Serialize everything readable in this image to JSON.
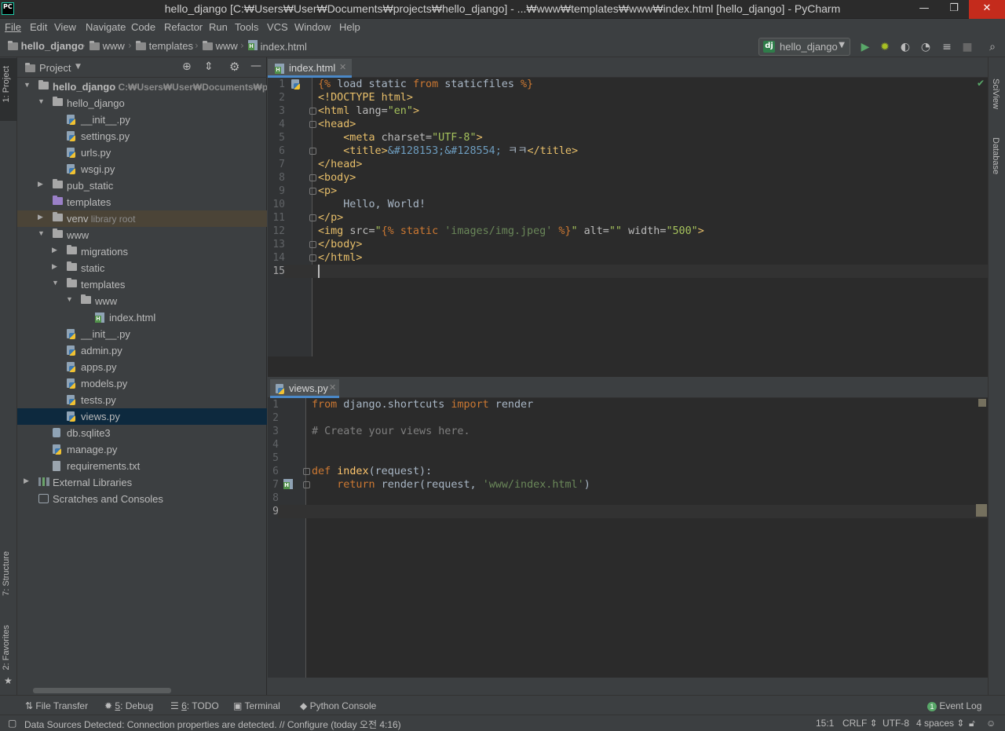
{
  "window": {
    "title": "hello_django [C:₩Users₩User₩Documents₩projects₩hello_django] - ...₩www₩templates₩www₩index.html [hello_django] - PyCharm",
    "logo": "PC",
    "minimize": "—",
    "maximize": "❐",
    "close": "✕"
  },
  "menu": [
    "File",
    "Edit",
    "View",
    "Navigate",
    "Code",
    "Refactor",
    "Run",
    "Tools",
    "VCS",
    "Window",
    "Help"
  ],
  "breadcrumb": [
    "hello_django",
    "www",
    "templates",
    "www",
    "index.html"
  ],
  "run_config": {
    "icon": "dj",
    "label": "hello_django"
  },
  "left_tool_tabs": {
    "project": "1: Project",
    "structure": "7: Structure",
    "favorites": "2: Favorites"
  },
  "right_tool_tabs": {
    "sciview": "SciView",
    "database": "Database"
  },
  "project_panel": {
    "title": "Project",
    "tree": [
      {
        "label": "hello_django",
        "extra": "C:₩Users₩User₩Documents₩projects",
        "icon": "folder",
        "arrow": "▼",
        "bold": true
      },
      {
        "label": "hello_django",
        "icon": "folder",
        "arrow": "▼"
      },
      {
        "label": "__init__.py",
        "icon": "python-file"
      },
      {
        "label": "settings.py",
        "icon": "python-file"
      },
      {
        "label": "urls.py",
        "icon": "python-file"
      },
      {
        "label": "wsgi.py",
        "icon": "python-file"
      },
      {
        "label": "pub_static",
        "icon": "folder",
        "arrow": "▶"
      },
      {
        "label": "templates",
        "icon": "folder-purple"
      },
      {
        "label": "venv",
        "extra": "library root",
        "icon": "folder",
        "arrow": "▶"
      },
      {
        "label": "www",
        "icon": "folder",
        "arrow": "▼"
      },
      {
        "label": "migrations",
        "icon": "folder",
        "arrow": "▶"
      },
      {
        "label": "static",
        "icon": "folder",
        "arrow": "▶"
      },
      {
        "label": "templates",
        "icon": "folder",
        "arrow": "▼"
      },
      {
        "label": "www",
        "icon": "folder",
        "arrow": "▼"
      },
      {
        "label": "index.html",
        "icon": "html-file"
      },
      {
        "label": "__init__.py",
        "icon": "python-file"
      },
      {
        "label": "admin.py",
        "icon": "python-file"
      },
      {
        "label": "apps.py",
        "icon": "python-file"
      },
      {
        "label": "models.py",
        "icon": "python-file"
      },
      {
        "label": "tests.py",
        "icon": "python-file"
      },
      {
        "label": "views.py",
        "icon": "python-file"
      },
      {
        "label": "db.sqlite3",
        "icon": "db-file"
      },
      {
        "label": "manage.py",
        "icon": "python-file"
      },
      {
        "label": "requirements.txt",
        "icon": "text-file"
      },
      {
        "label": "External Libraries",
        "icon": "library",
        "arrow": "▶"
      },
      {
        "label": "Scratches and Consoles",
        "icon": "scratches"
      }
    ]
  },
  "editor_top": {
    "tab": "index.html",
    "line_numbers": [
      "1",
      "2",
      "3",
      "4",
      "5",
      "6",
      "7",
      "8",
      "9",
      "10",
      "11",
      "12",
      "13",
      "14",
      "15"
    ],
    "lines": [
      [
        {
          "t": "{% ",
          "c": "templ"
        },
        {
          "t": "load static ",
          "c": "plain"
        },
        {
          "t": "from",
          "c": "kw"
        },
        {
          "t": " staticfiles ",
          "c": "plain"
        },
        {
          "t": "%}",
          "c": "templ"
        }
      ],
      [
        {
          "t": "<!DOCTYPE html>",
          "c": "tag"
        }
      ],
      [
        {
          "t": "<html ",
          "c": "tag"
        },
        {
          "t": "lang=",
          "c": "attr"
        },
        {
          "t": "\"en\"",
          "c": "val"
        },
        {
          "t": ">",
          "c": "tag"
        }
      ],
      [
        {
          "t": "<head>",
          "c": "tag"
        }
      ],
      [
        {
          "t": "    ",
          "c": "plain"
        },
        {
          "t": "<meta ",
          "c": "tag"
        },
        {
          "t": "charset=",
          "c": "attr"
        },
        {
          "t": "\"UTF-8\"",
          "c": "val"
        },
        {
          "t": ">",
          "c": "tag"
        }
      ],
      [
        {
          "t": "    ",
          "c": "plain"
        },
        {
          "t": "<title>",
          "c": "tag"
        },
        {
          "t": "&#128153;&#128554;",
          "c": "ent"
        },
        {
          "t": " ㅋㅋ",
          "c": "plain"
        },
        {
          "t": "</title>",
          "c": "tag"
        }
      ],
      [
        {
          "t": "</head>",
          "c": "tag"
        }
      ],
      [
        {
          "t": "<body>",
          "c": "tag"
        }
      ],
      [
        {
          "t": "<p>",
          "c": "tag"
        }
      ],
      [
        {
          "t": "    Hello, World!",
          "c": "plain"
        }
      ],
      [
        {
          "t": "</p>",
          "c": "tag"
        }
      ],
      [
        {
          "t": "<img ",
          "c": "tag"
        },
        {
          "t": "src=",
          "c": "attr"
        },
        {
          "t": "\"",
          "c": "val"
        },
        {
          "t": "{% ",
          "c": "templ"
        },
        {
          "t": "static ",
          "c": "kw"
        },
        {
          "t": "'images/img.jpeg'",
          "c": "str"
        },
        {
          "t": " %}",
          "c": "templ"
        },
        {
          "t": "\" ",
          "c": "val"
        },
        {
          "t": "alt=",
          "c": "attr"
        },
        {
          "t": "\"\" ",
          "c": "val"
        },
        {
          "t": "width=",
          "c": "attr"
        },
        {
          "t": "\"500\"",
          "c": "val"
        },
        {
          "t": ">",
          "c": "tag"
        }
      ],
      [
        {
          "t": "</body>",
          "c": "tag"
        }
      ],
      [
        {
          "t": "</html>",
          "c": "tag"
        }
      ],
      []
    ]
  },
  "editor_bottom": {
    "tab": "views.py",
    "line_numbers": [
      "1",
      "2",
      "3",
      "4",
      "5",
      "6",
      "7",
      "8",
      "9"
    ],
    "lines": [
      [
        {
          "t": "from",
          "c": "kw"
        },
        {
          "t": " django.shortcuts ",
          "c": "plain"
        },
        {
          "t": "import",
          "c": "kw"
        },
        {
          "t": " render",
          "c": "plain"
        }
      ],
      [],
      [
        {
          "t": "# Create your views here.",
          "c": "cmt"
        }
      ],
      [],
      [],
      [
        {
          "t": "def ",
          "c": "kw"
        },
        {
          "t": "index",
          "c": "fn"
        },
        {
          "t": "(request):",
          "c": "plain"
        }
      ],
      [
        {
          "t": "    ",
          "c": "plain"
        },
        {
          "t": "return",
          "c": "kw"
        },
        {
          "t": " render(request, ",
          "c": "plain"
        },
        {
          "t": "'www/index.html'",
          "c": "str"
        },
        {
          "t": ")",
          "c": "plain"
        }
      ],
      [],
      []
    ]
  },
  "bottom_tools": [
    {
      "icon": "⇅",
      "label": "File Transfer"
    },
    {
      "icon": "✹",
      "key": "5",
      "label": ": Debug"
    },
    {
      "icon": "☰",
      "key": "6",
      "label": ": TODO"
    },
    {
      "icon": "▣",
      "label": "Terminal"
    },
    {
      "icon": "◆",
      "label": "Python Console"
    }
  ],
  "event_log": {
    "badge": "1",
    "label": "Event Log"
  },
  "status": {
    "message": "Data Sources Detected: Connection properties are detected. // Configure (today 오전 4:16)",
    "position": "15:1",
    "line_sep": "CRLF ⇕",
    "encoding": "UTF-8",
    "indent": "4 spaces ⇕"
  },
  "colors": {
    "accent": "#4a88c7",
    "selection": "#0d293e",
    "editor_bg": "#2b2b2b",
    "panel_bg": "#3c3f41"
  }
}
